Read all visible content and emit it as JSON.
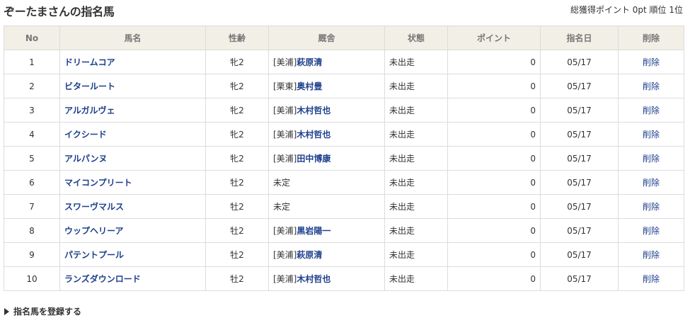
{
  "page": {
    "title": "ぞーたまさんの指名馬",
    "summary": "総獲得ポイント 0pt 順位 1位"
  },
  "table": {
    "headers": [
      "No",
      "馬名",
      "性齢",
      "厩舎",
      "状態",
      "ポイント",
      "指名日",
      "削除"
    ],
    "rows": [
      {
        "no": "1",
        "name": "ドリームコア",
        "sexage": "牝2",
        "region": "[美浦]",
        "trainer": "萩原清",
        "status": "未出走",
        "points": "0",
        "date": "05/17",
        "delete": "削除"
      },
      {
        "no": "2",
        "name": "ビタールート",
        "sexage": "牝2",
        "region": "[栗東]",
        "trainer": "奥村豊",
        "status": "未出走",
        "points": "0",
        "date": "05/17",
        "delete": "削除"
      },
      {
        "no": "3",
        "name": "アルガルヴェ",
        "sexage": "牝2",
        "region": "[美浦]",
        "trainer": "木村哲也",
        "status": "未出走",
        "points": "0",
        "date": "05/17",
        "delete": "削除"
      },
      {
        "no": "4",
        "name": "イクシード",
        "sexage": "牝2",
        "region": "[美浦]",
        "trainer": "木村哲也",
        "status": "未出走",
        "points": "0",
        "date": "05/17",
        "delete": "削除"
      },
      {
        "no": "5",
        "name": "アルパンヌ",
        "sexage": "牝2",
        "region": "[美浦]",
        "trainer": "田中博康",
        "status": "未出走",
        "points": "0",
        "date": "05/17",
        "delete": "削除"
      },
      {
        "no": "6",
        "name": "マイコンプリート",
        "sexage": "牡2",
        "region": "",
        "trainer": "未定",
        "status": "未出走",
        "points": "0",
        "date": "05/17",
        "delete": "削除"
      },
      {
        "no": "7",
        "name": "スワーヴマルス",
        "sexage": "牡2",
        "region": "",
        "trainer": "未定",
        "status": "未出走",
        "points": "0",
        "date": "05/17",
        "delete": "削除"
      },
      {
        "no": "8",
        "name": "ウップヘリーア",
        "sexage": "牡2",
        "region": "[美浦]",
        "trainer": "黒岩陽一",
        "status": "未出走",
        "points": "0",
        "date": "05/17",
        "delete": "削除"
      },
      {
        "no": "9",
        "name": "パテントプール",
        "sexage": "牡2",
        "region": "[美浦]",
        "trainer": "萩原清",
        "status": "未出走",
        "points": "0",
        "date": "05/17",
        "delete": "削除"
      },
      {
        "no": "10",
        "name": "ランズダウンロード",
        "sexage": "牡2",
        "region": "[美浦]",
        "trainer": "木村哲也",
        "status": "未出走",
        "points": "0",
        "date": "05/17",
        "delete": "削除"
      }
    ]
  },
  "footer": {
    "register_label": "指名馬を登録する"
  },
  "colors": {
    "link": "#1d3f8c",
    "header_bg": "#f2efe6",
    "border": "#dcdcdc"
  }
}
